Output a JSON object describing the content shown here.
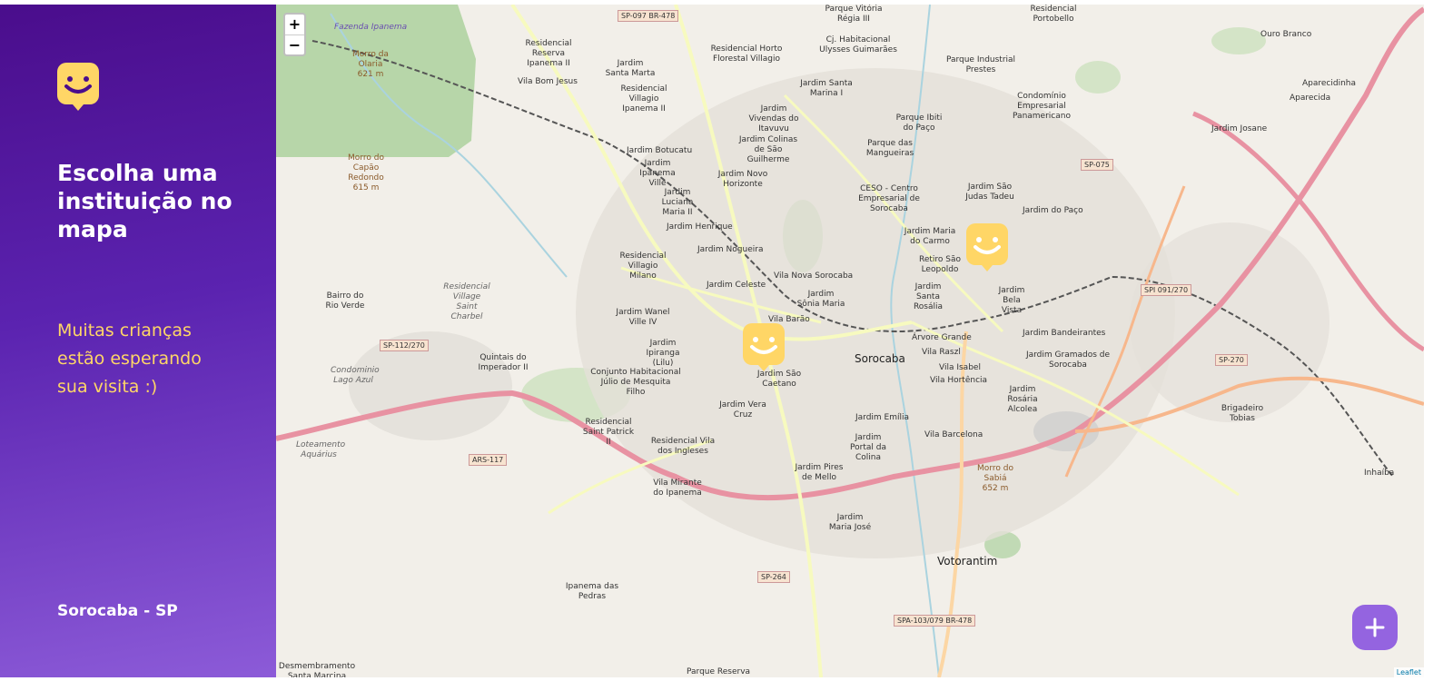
{
  "sidebar": {
    "title": "Escolha uma instituição no mapa",
    "subtitle": "Muitas crianças estão esperando sua visita :)",
    "city": "Sorocaba - SP",
    "logo_icon": "smile-face-icon",
    "colors": {
      "gradient_start": "#4a0d8c",
      "gradient_end": "#8c5bd8",
      "subtitle": "#ffd666"
    }
  },
  "map": {
    "zoom_in_label": "+",
    "zoom_out_label": "−",
    "attribution": "Leaflet",
    "marker_icon": "smile-face-icon",
    "marker_color": "#ffd666",
    "labels": [
      "Sorocaba",
      "Votorantim",
      "Jardim São Caetano",
      "Jardim Vera Cruz",
      "Jardim Emília",
      "Jardim Portal da Colina",
      "Jardim Pires de Mello",
      "Vila Barcelona",
      "Vila Isabel",
      "Vila Hortência",
      "Vila Raszl",
      "Árvore Grande",
      "Jardim Bela Vista",
      "Jardim Bandeirantes",
      "Jardim Gramados de Sorocaba",
      "Jardim Rosária Alcolea",
      "Brigadeiro Tobias",
      "Inhaíba",
      "Jardim Maria do Carmo",
      "Retiro São Leopoldo",
      "Jardim Santa Rosália",
      "Jardim São Judas Tadeu",
      "Jardim do Paço",
      "CESO - Centro Empresarial de Sorocaba",
      "Parque das Mangueiras",
      "Parque Ibiti do Paço",
      "Condomínio Empresarial Panamericano",
      "Parque Industrial Prestes",
      "Aparecidinha",
      "Aparecida",
      "Jardim Josane",
      "Ouro Branco",
      "Residencial Portobello",
      "Cj. Habitacional Ulysses Guimarães",
      "Parque Vitória Régia III",
      "Jardim Santa Marina I",
      "Jardim Vivendas do Itavuvu",
      "Jardim Colinas de São Guilherme",
      "Jardim Novo Horizonte",
      "Residencial Horto Florestal Villagio",
      "Residencial Reserva Ipanema II",
      "Jardim Santa Marta",
      "Vila Bom Jesus",
      "Residencial Villagio Ipanema II",
      "Jardim Botucatu",
      "Jardim Ipanema Ville",
      "Jardim Luciana Maria II",
      "Jardim Henrique",
      "Jardim Nogueira",
      "Residencial Villagio Milano",
      "Vila Nova Sorocaba",
      "Jardim Celeste",
      "Jardim Sônia Maria",
      "Vila Barão",
      "Jardim Wanel Ville IV",
      "Jardim Ipiranga (Lilu)",
      "Conjunto Habitacional Júlio de Mesquita Filho",
      "Residencial Saint Patrick II",
      "Residencial Vila dos Ingleses",
      "Vila Mirante do Ipanema",
      "Jardim Maria José",
      "Quintais do Imperador II",
      "Bairro do Rio Verde",
      "Residencial Village Saint Charbel",
      "Condominio Lago Azul",
      "Loteamento Aquárius",
      "Ipanema das Pedras",
      "Parque Reserva",
      "Desmembramento Santa Marcina",
      "Morro do Capão Redondo 615 m",
      "Morro da Olaria 621 m",
      "Morro do Sabiá 652 m",
      "Fazenda Ipanema"
    ],
    "shields": [
      "SP-097 BR-478",
      "SP-075",
      "SPI 091/270",
      "SP-270",
      "SP-112/270",
      "ARS-117",
      "SP-264",
      "SPA-103/079 BR-478"
    ]
  },
  "actions": {
    "add_label": "+",
    "add_color": "#9464e0"
  }
}
